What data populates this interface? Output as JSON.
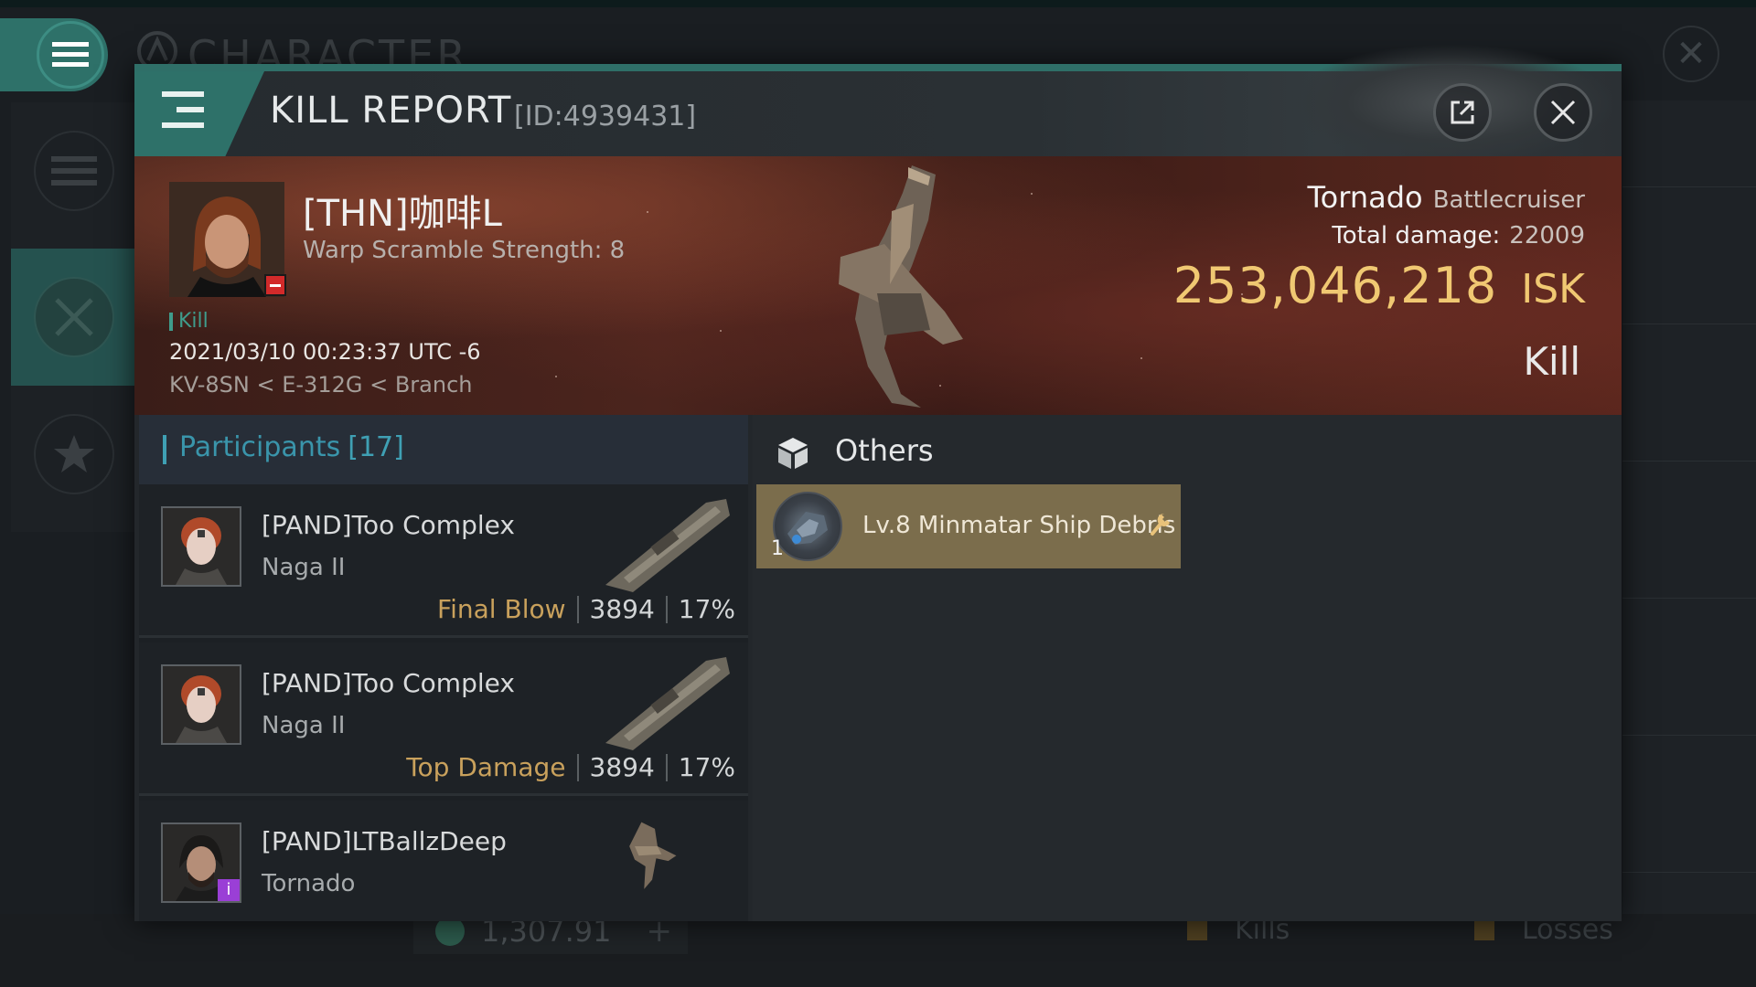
{
  "background": {
    "title": "CHARACTER",
    "wallet_value": "1,307.91",
    "legend": [
      "Kills",
      "Losses"
    ]
  },
  "modal": {
    "title": "KILL REPORT",
    "report_id": "[ID:4939431]"
  },
  "victim": {
    "name": "[THN]咖啡L",
    "warp_scramble": "Warp Scramble Strength: 8",
    "tag": "Kill",
    "datetime": "2021/03/10 00:23:37 UTC -6",
    "location": "KV-8SN < E-312G < Branch",
    "ship_name": "Tornado",
    "ship_class": "Battlecruiser",
    "total_damage_label": "Total damage:",
    "total_damage": "22009",
    "isk_value": "253,046,218",
    "isk_unit": "ISK",
    "kill_type": "Kill"
  },
  "participants": {
    "title": "Participants",
    "count": "[17]",
    "rows": [
      {
        "name": "[PAND]Too Complex",
        "ship": "Naga II",
        "tag": "Final Blow",
        "damage": "3894",
        "percent": "17%"
      },
      {
        "name": "[PAND]Too Complex",
        "ship": "Naga II",
        "tag": "Top Damage",
        "damage": "3894",
        "percent": "17%"
      },
      {
        "name": "[PAND]LTBallzDeep",
        "ship": "Tornado",
        "tag": "",
        "damage": "",
        "percent": ""
      }
    ]
  },
  "others": {
    "title": "Others",
    "items": [
      {
        "quantity": "1",
        "name": "Lv.8 Minmatar Ship Debris"
      }
    ]
  },
  "colors": {
    "accent": "#2e7169",
    "isk": "#f0c872",
    "tag_gold": "#c9a15c",
    "participants_blue": "#3a95ab",
    "item_card": "#7b6d4c"
  },
  "icons": [
    "menu-icon",
    "external-link-icon",
    "close-icon",
    "cube-icon",
    "wrench-icon",
    "star-icon",
    "crossed-swords-icon"
  ]
}
